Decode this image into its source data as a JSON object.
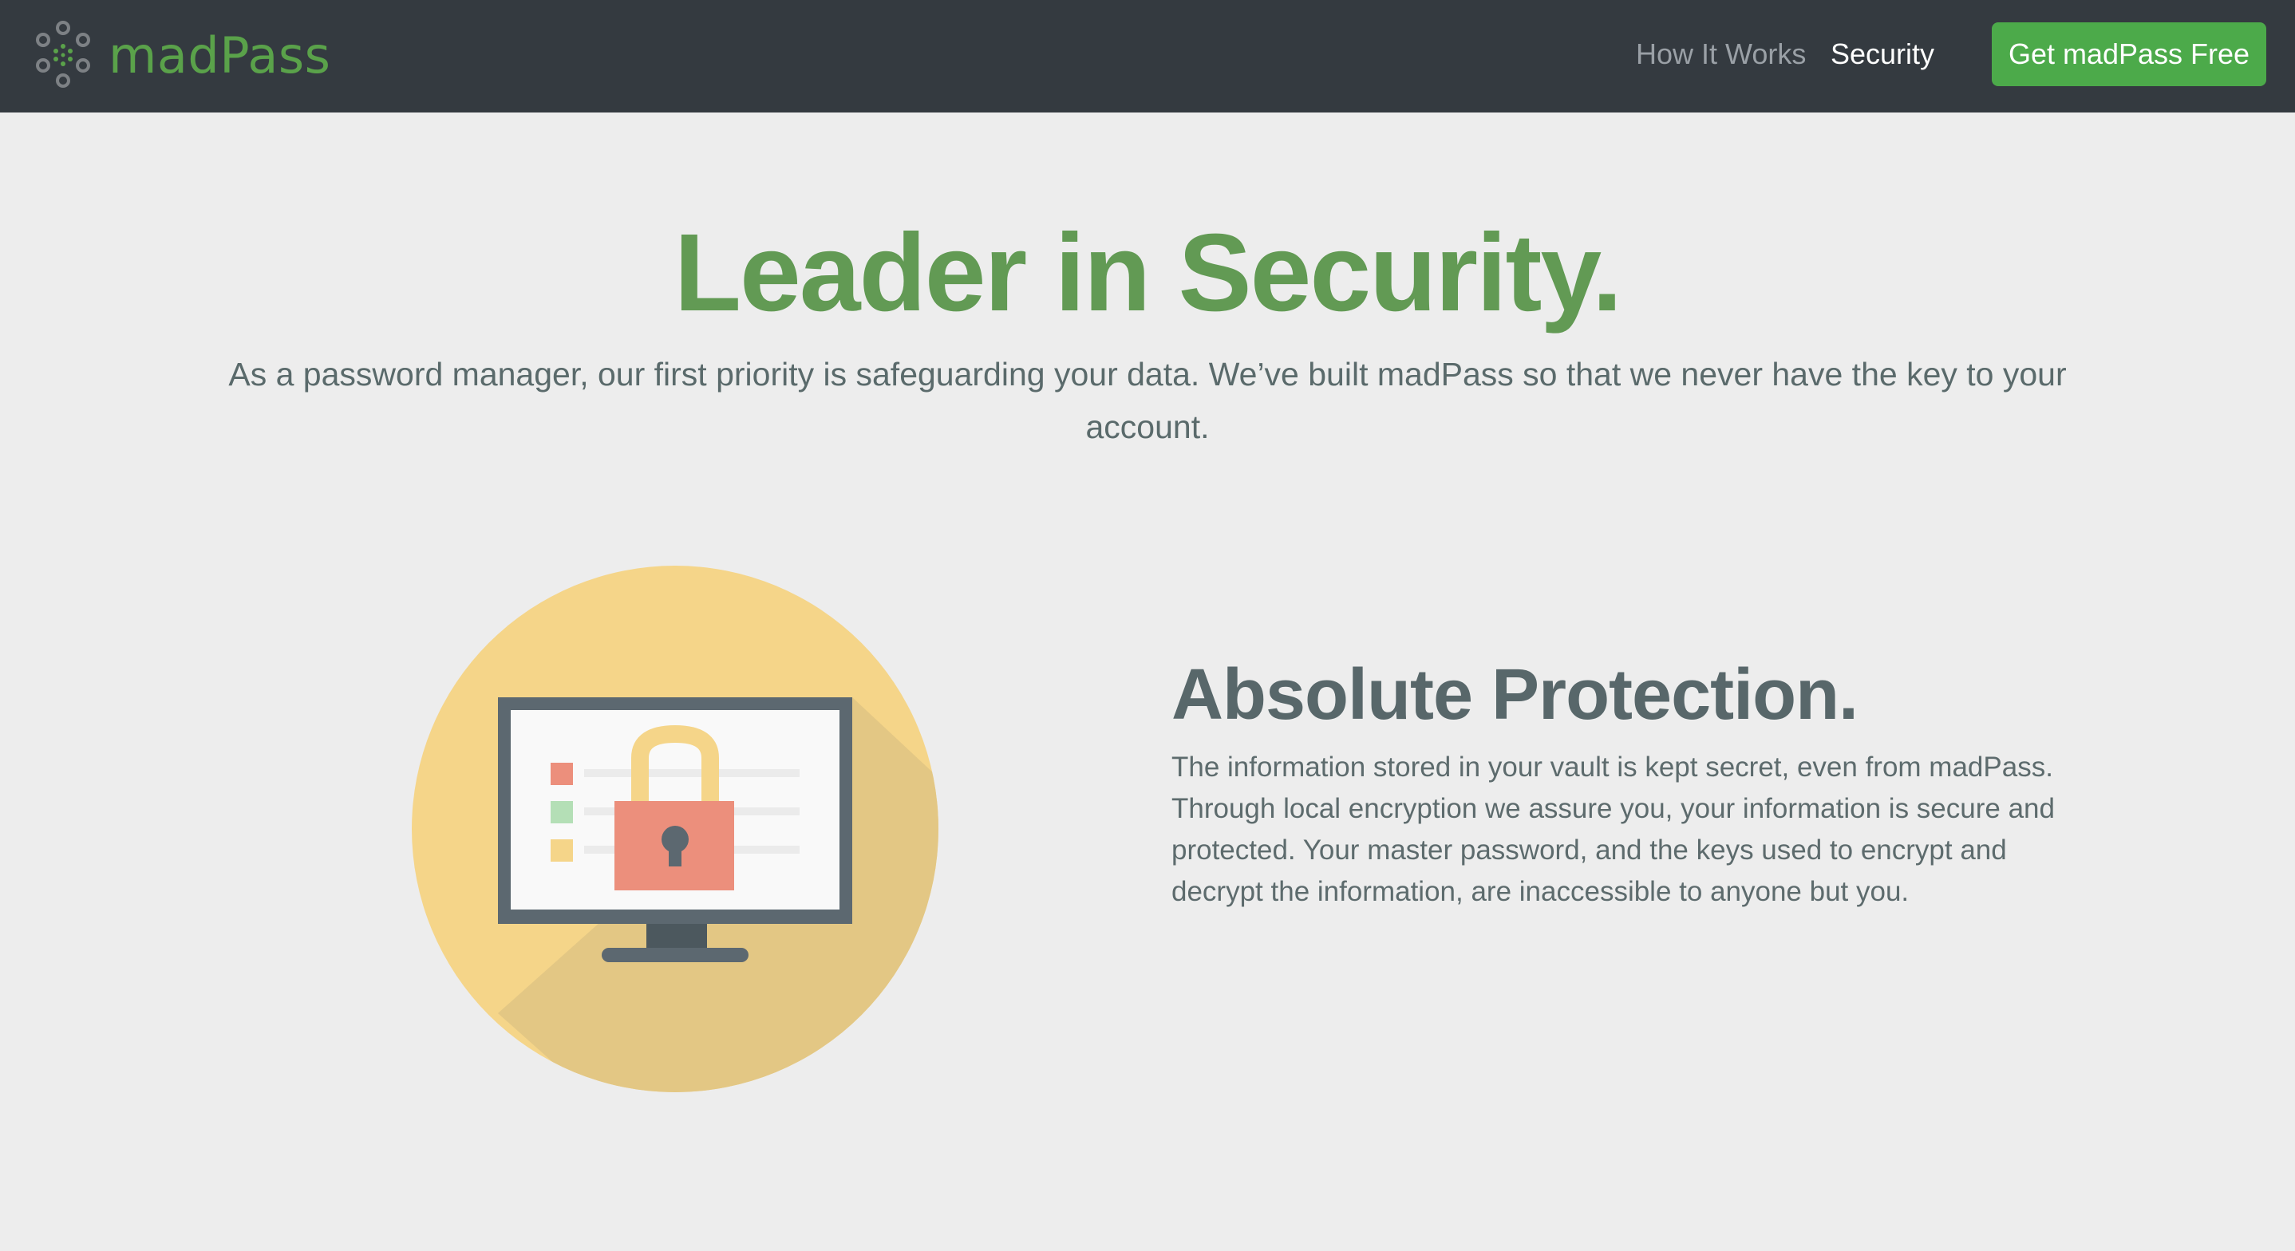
{
  "brand": {
    "name": "madPass",
    "logo_icon": "dots-ring-logo-icon"
  },
  "nav": {
    "items": [
      {
        "label": "How It Works",
        "active": false
      },
      {
        "label": "Security",
        "active": true
      }
    ],
    "cta_label": "Get madPass Free"
  },
  "hero": {
    "title": "Leader in Security.",
    "subtitle": "As a password manager, our first priority is safeguarding your data. We’ve built madPass so that we never have the key to your account."
  },
  "feature": {
    "illustration_icon": "monitor-padlock-icon",
    "title": "Absolute Protection.",
    "body": "The information stored in your vault is kept secret, even from madPass. Through local encryption we assure you, your information is secure and protected. Your master password, and the keys used to encrypt and decrypt the information, are inaccessible to anyone but you."
  },
  "colors": {
    "navbar_bg": "#343a40",
    "brand_green": "#5aa24a",
    "cta_green": "#4caa4a",
    "hero_title_green": "#629a54",
    "page_bg": "#ededed",
    "circle_yellow": "#f5d589",
    "lock_red": "#ec8f7c"
  }
}
